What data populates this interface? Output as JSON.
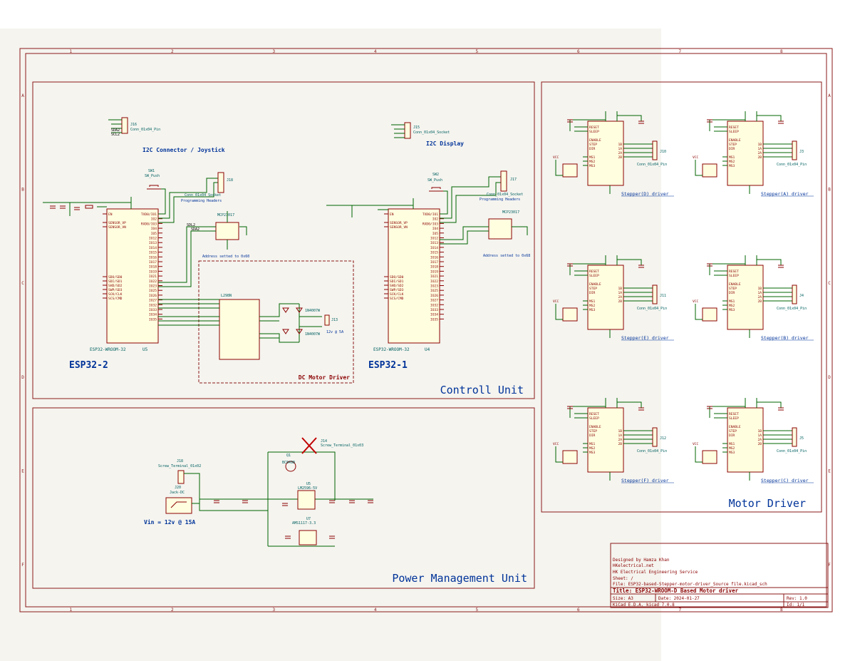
{
  "colors": {
    "frame": "#8b1a1a",
    "wire": "#006400",
    "part": "#8b0000",
    "body": "#ffffe0",
    "label": "#003399"
  },
  "ruler": {
    "columns": [
      "1",
      "2",
      "3",
      "4",
      "5",
      "6",
      "7",
      "8"
    ],
    "rows": [
      "A",
      "B",
      "C",
      "D",
      "E",
      "F"
    ]
  },
  "sections": {
    "control": "Controll Unit",
    "power": "Power Management Unit",
    "motor": "Motor Driver",
    "dc_motor": "DC Motor Driver"
  },
  "modules": {
    "esp2": {
      "title": "ESP32-2",
      "ref": "U5",
      "part": "ESP32-WROOM-32"
    },
    "esp1": {
      "title": "ESP32-1",
      "ref": "U4",
      "part": "ESP32-WROOM-32"
    },
    "i2c_joystick": "I2C Connector / Joystick",
    "i2c_display": "I2C Display",
    "prog_headers": "Programming Headers",
    "addr_left": "Address setted to 0x60",
    "addr_right": "Address setted to 0x68",
    "vin_label": "Vin = 12v @ 15A",
    "motor_out": "12v @ 5A",
    "mcp_left": "MCP23017",
    "mcp_right": "MCP23017",
    "dc_driver_ic": "L298N",
    "reg1": "LM2596-5V",
    "reg2": "AMS1117-3.3",
    "screw": "Screw_Terminal_01x02",
    "jack": "Jack-DC"
  },
  "steppers": [
    {
      "label": "Stepper(D) driver",
      "conn": "Conn_01x04_Pin",
      "ref": "J10"
    },
    {
      "label": "Stepper(A) driver",
      "conn": "Conn_01x04_Pin",
      "ref": "J3"
    },
    {
      "label": "Stepper(E) driver",
      "conn": "Conn_01x04_Pin",
      "ref": "J11"
    },
    {
      "label": "Stepper(B) driver",
      "conn": "Conn_01x04_Pin",
      "ref": "J4"
    },
    {
      "label": "Stepper(F) driver",
      "conn": "Conn_01x04_Pin",
      "ref": "J12"
    },
    {
      "label": "Stepper(C) driver",
      "conn": "Conn_01x04_Pin",
      "ref": "J5"
    }
  ],
  "stepper_pins_left": [
    "RESET",
    "SLEEP",
    "ENABLE",
    "STEP",
    "DIR",
    "MS1",
    "MS2",
    "MS3"
  ],
  "stepper_pins_right": [
    "1B",
    "1A",
    "2A",
    "2B"
  ],
  "esp_pins_left": [
    "EN",
    "SENSOR_VP",
    "SENSOR_VN",
    "SDO/SD0",
    "SDI/SD1",
    "SHD/SD2",
    "SWP/SD3",
    "SCK/CLK",
    "SCS/CMD"
  ],
  "esp_pins_right": [
    "TXD0/IO1",
    "IO2",
    "RXD0/IO3",
    "IO4",
    "IO5",
    "IO12",
    "IO13",
    "IO14",
    "IO15",
    "IO16",
    "IO17",
    "IO18",
    "IO19",
    "IO21",
    "IO22",
    "IO23",
    "IO25",
    "IO26",
    "IO27",
    "IO32",
    "IO33",
    "IO34",
    "IO35"
  ],
  "title_block": {
    "designer": "Designed by Hamza Khan",
    "company": "HKelectrical.net",
    "service": "HK Electrical Engineering Service",
    "sheet": "Sheet: /",
    "file": "File: ESP32-based-Stepper-motor-driver_Source file.kicad_sch",
    "title": "Title: ESP32-WROOM-D Based Motor driver",
    "size": "Size: A3",
    "date": "Date: 2024-01-27",
    "rev": "Rev: 1.0",
    "tool": "KiCad E.D.A.  kicad 7.0.8",
    "id": "Id: 1/1"
  }
}
